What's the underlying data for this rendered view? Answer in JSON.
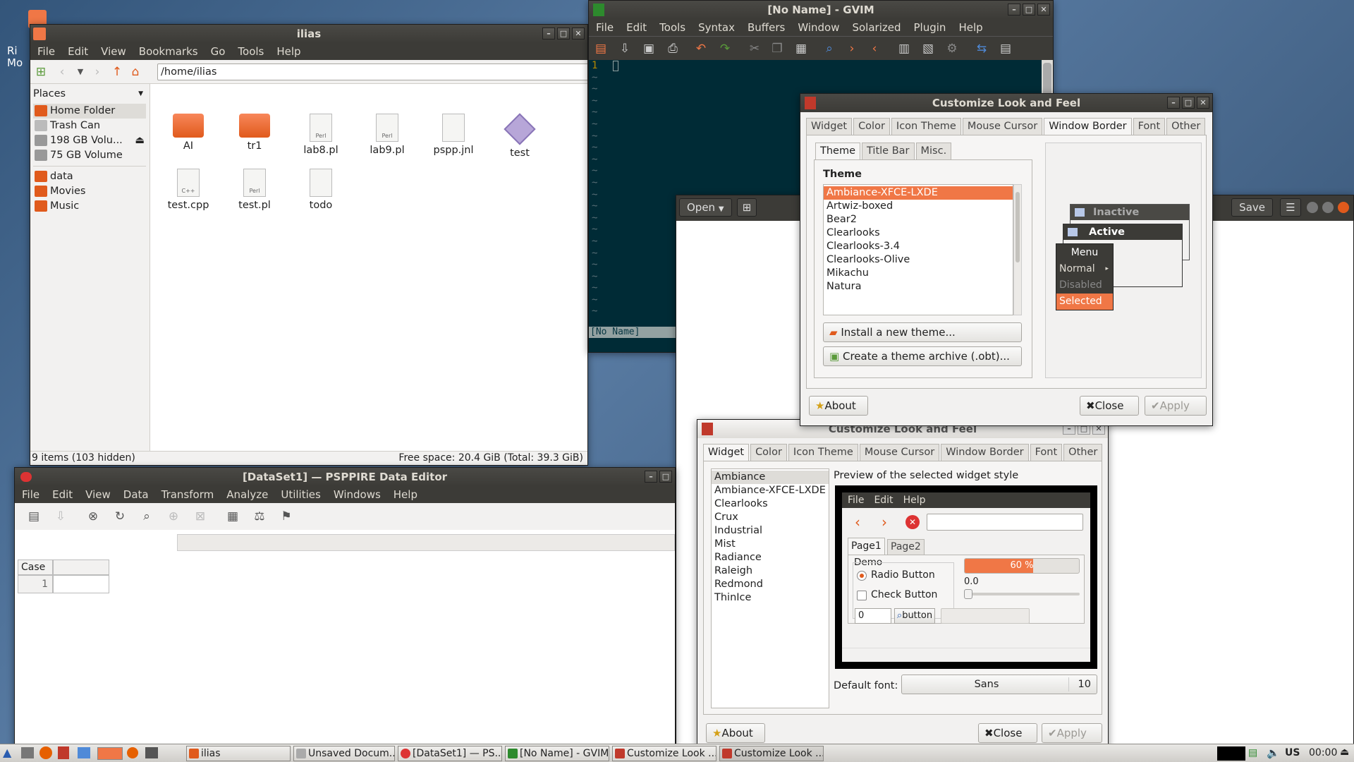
{
  "desktop": {
    "partial_label": "Ri Mo"
  },
  "file_manager": {
    "title": "ilias",
    "menu": [
      "File",
      "Edit",
      "View",
      "Bookmarks",
      "Go",
      "Tools",
      "Help"
    ],
    "path": "/home/ilias",
    "places_label": "Places",
    "places": [
      "Home Folder",
      "Trash Can",
      "198 GB Volu...",
      "75 GB Volume"
    ],
    "bookmarks": [
      "data",
      "Movies",
      "Music"
    ],
    "files": [
      {
        "name": "AI",
        "kind": "folder"
      },
      {
        "name": "tr1",
        "kind": "folder"
      },
      {
        "name": "lab8.pl",
        "kind": "Perl"
      },
      {
        "name": "lab9.pl",
        "kind": "Perl"
      },
      {
        "name": "pspp.jnl",
        "kind": "text"
      },
      {
        "name": "test",
        "kind": "executable"
      },
      {
        "name": "test.cpp",
        "kind": "C++"
      },
      {
        "name": "test.pl",
        "kind": "Perl"
      },
      {
        "name": "todo",
        "kind": "text"
      }
    ],
    "status_left": "9 items (103 hidden)",
    "status_right": "Free space: 20.4 GiB (Total: 39.3 GiB)"
  },
  "gvim": {
    "title": "[No Name] - GVIM",
    "menu": [
      "File",
      "Edit",
      "Tools",
      "Syntax",
      "Buffers",
      "Window",
      "Solarized",
      "Plugin",
      "Help"
    ],
    "line_number": "1",
    "tilde": "~",
    "statusline": "[No Name]",
    "colors": {
      "bg": "#002b36",
      "linenr": "#b58900",
      "tilde": "#586e75"
    }
  },
  "gedit": {
    "open_label": "Open",
    "save_label": "Save"
  },
  "pspp": {
    "title": "[DataSet1] — PSPPIRE Data Editor",
    "menu": [
      "File",
      "Edit",
      "View",
      "Data",
      "Transform",
      "Analyze",
      "Utilities",
      "Windows",
      "Help"
    ],
    "column_header": "Case",
    "row_number": "1"
  },
  "customize_top": {
    "title": "Customize Look and Feel",
    "tabs": [
      "Widget",
      "Color",
      "Icon Theme",
      "Mouse Cursor",
      "Window Border",
      "Font",
      "Other"
    ],
    "active_tab": "Window Border",
    "subtabs": [
      "Theme",
      "Title Bar",
      "Misc."
    ],
    "section_label": "Theme",
    "themes": [
      "Ambiance-XFCE-LXDE",
      "Artwiz-boxed",
      "Bear2",
      "Clearlooks",
      "Clearlooks-3.4",
      "Clearlooks-Olive",
      "Mikachu",
      "Natura"
    ],
    "selected_theme": "Ambiance-XFCE-LXDE",
    "install_label": "Install a new theme...",
    "archive_label": "Create a theme archive (.obt)...",
    "about_label": "About",
    "close_label": "Close",
    "apply_label": "Apply",
    "preview": {
      "inactive": "Inactive",
      "active": "Active",
      "menu_title": "Menu",
      "items": [
        "Normal",
        "Disabled",
        "Selected"
      ]
    }
  },
  "customize_bottom": {
    "title": "Customize Look and Feel",
    "tabs": [
      "Widget",
      "Color",
      "Icon Theme",
      "Mouse Cursor",
      "Window Border",
      "Font",
      "Other"
    ],
    "active_tab": "Widget",
    "widget_themes": [
      "Ambiance",
      "Ambiance-XFCE-LXDE",
      "Clearlooks",
      "Crux",
      "Industrial",
      "Mist",
      "Radiance",
      "Raleigh",
      "Redmond",
      "ThinIce"
    ],
    "selected_widget": "Ambiance",
    "preview_label": "Preview of the selected widget style",
    "preview": {
      "menu": [
        "File",
        "Edit",
        "Help"
      ],
      "tabs": [
        "Page1",
        "Page2"
      ],
      "group_label": "Demo",
      "radio_label": "Radio Button",
      "check_label": "Check Button",
      "progress_text": "60 %",
      "progress_value": 0.6,
      "slider_value": "0.0",
      "spin_value": "0",
      "button_label": "button"
    },
    "default_font_label": "Default font:",
    "font_name": "Sans",
    "font_size": "10",
    "about_label": "About",
    "close_label": "Close",
    "apply_label": "Apply"
  },
  "taskbar": {
    "items": [
      "ilias",
      "Unsaved Docum...",
      "[DataSet1] — PS...",
      "[No Name] - GVIM",
      "Customize Look ...",
      "Customize Look ..."
    ],
    "keyboard_layout": "US",
    "clock": "00:00"
  },
  "colors": {
    "accent": "#f07746",
    "dark_chrome": "#3c3b37",
    "panel": "#f2f1f0"
  }
}
